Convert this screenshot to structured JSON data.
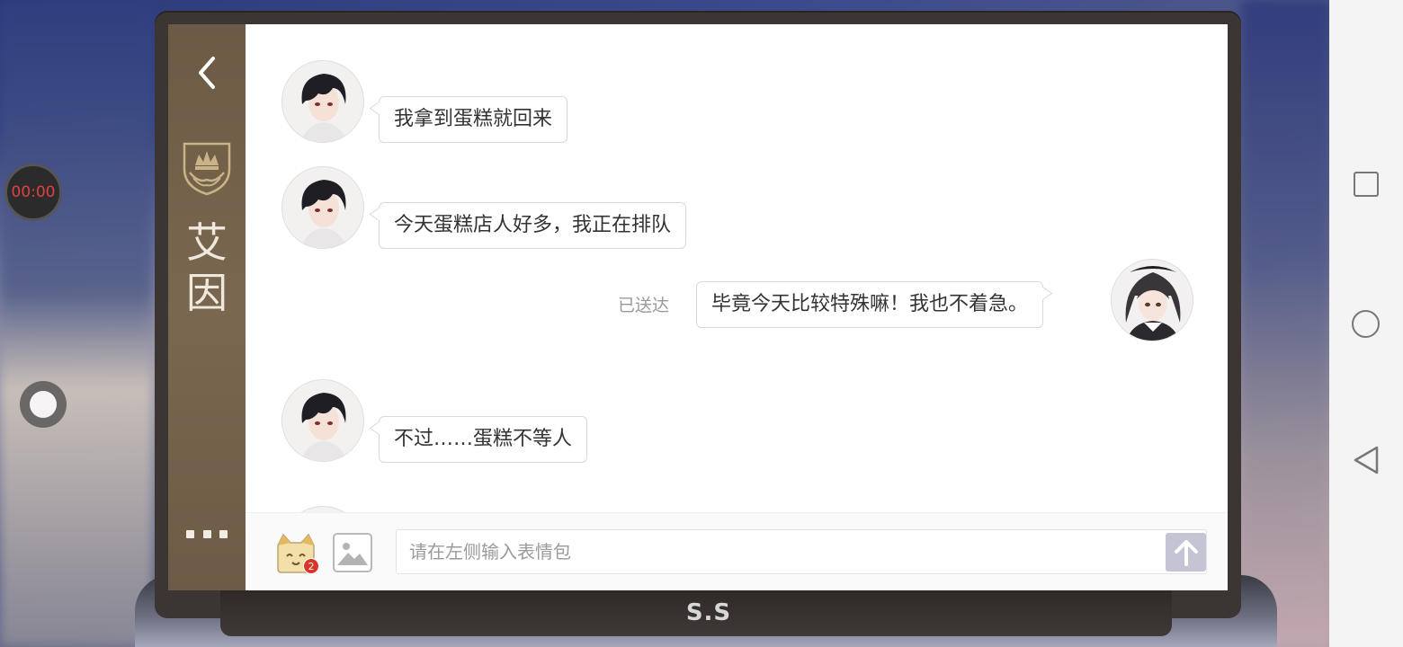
{
  "recorder": {
    "time": "00:00"
  },
  "sidebar": {
    "contact_name": "艾因"
  },
  "messages": [
    {
      "sender": "contact",
      "text": "我拿到蛋糕就回来"
    },
    {
      "sender": "contact",
      "text": "今天蛋糕店人好多，我正在排队"
    },
    {
      "sender": "me",
      "text": "毕竟今天比较特殊嘛！我也不着急。",
      "status": "已送达"
    },
    {
      "sender": "contact",
      "text": "不过……蛋糕不等人"
    }
  ],
  "input_bar": {
    "placeholder": "请在左侧输入表情包",
    "emoji_badge_count": "2"
  },
  "device": {
    "brand": "S.S"
  },
  "icons": {
    "back": "chevron-left-icon",
    "crest": "crown-crest-icon",
    "more": "more-dots-icon",
    "emoji": "cat-emoji-icon",
    "image": "image-icon",
    "send": "arrow-up-icon",
    "nav_recents": "square-icon",
    "nav_home": "circle-icon",
    "nav_back": "triangle-back-icon"
  },
  "colors": {
    "sidebar": "#6c5a44",
    "frame": "#3b3534",
    "send_button": "#c4c4d4",
    "badge": "#d9362b",
    "timer_text": "#e04040"
  }
}
